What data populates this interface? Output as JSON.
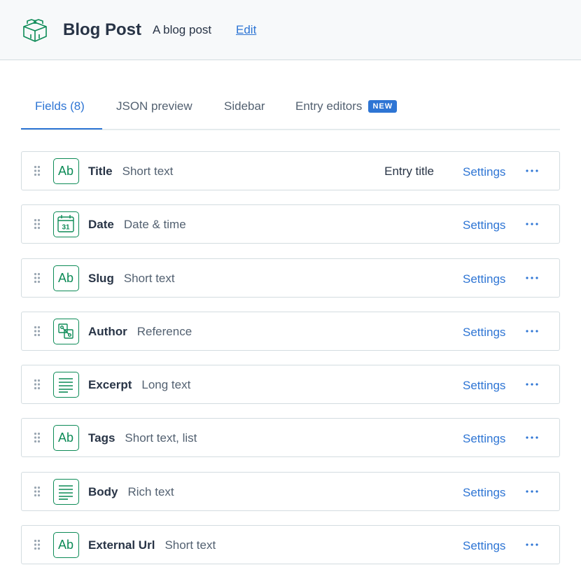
{
  "header": {
    "title": "Blog Post",
    "description": "A blog post",
    "edit_label": "Edit",
    "icon": "content-type-cube-icon"
  },
  "tabs": [
    {
      "label": "Fields (8)",
      "active": true
    },
    {
      "label": "JSON preview",
      "active": false
    },
    {
      "label": "Sidebar",
      "active": false
    },
    {
      "label": "Entry editors",
      "active": false,
      "badge": "NEW"
    }
  ],
  "fields": [
    {
      "name": "Title",
      "type": "Short text",
      "icon": "short-text-icon",
      "entry_title_label": "Entry title",
      "settings_label": "Settings"
    },
    {
      "name": "Date",
      "type": "Date & time",
      "icon": "date-icon",
      "settings_label": "Settings"
    },
    {
      "name": "Slug",
      "type": "Short text",
      "icon": "short-text-icon",
      "settings_label": "Settings"
    },
    {
      "name": "Author",
      "type": "Reference",
      "icon": "reference-icon",
      "settings_label": "Settings"
    },
    {
      "name": "Excerpt",
      "type": "Long text",
      "icon": "long-text-icon",
      "settings_label": "Settings"
    },
    {
      "name": "Tags",
      "type": "Short text, list",
      "icon": "short-text-icon",
      "settings_label": "Settings"
    },
    {
      "name": "Body",
      "type": "Rich text",
      "icon": "long-text-icon",
      "settings_label": "Settings"
    },
    {
      "name": "External Url",
      "type": "Short text",
      "icon": "short-text-icon",
      "settings_label": "Settings"
    }
  ],
  "icon_text": {
    "short_text": "Ab",
    "date_day": "31"
  },
  "colors": {
    "accent": "#2e75d4",
    "icon_green": "#0d8b57",
    "border": "#d3dce0",
    "header_bg": "#f7f9fa",
    "text_dark": "#283446",
    "text_muted": "#536171"
  }
}
